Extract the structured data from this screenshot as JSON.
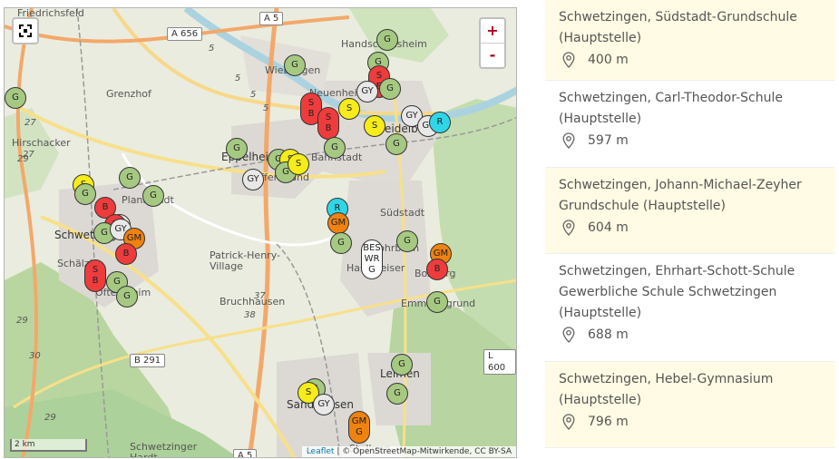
{
  "map": {
    "places": [
      {
        "id": "friedrichsfeld",
        "label": "Friedrichsfeld"
      },
      {
        "id": "handschuhsheim",
        "label": "Handschuhsheim"
      },
      {
        "id": "wieblingen",
        "label": "Wieblingen"
      },
      {
        "id": "neuenheim",
        "label": "Neuenheim"
      },
      {
        "id": "grenzhof",
        "label": "Grenzhof"
      },
      {
        "id": "hirschacker",
        "label": "Hirschacker"
      },
      {
        "id": "heidelberg",
        "label": "Heidelberg"
      },
      {
        "id": "eppelheim",
        "label": "Eppelheim"
      },
      {
        "id": "pfaffengrund",
        "label": "Pfaffengrund"
      },
      {
        "id": "bahnstadt",
        "label": "Bahnstadt"
      },
      {
        "id": "plankstadt",
        "label": "Plankstadt"
      },
      {
        "id": "schwetzingen",
        "label": "Schwetzingen"
      },
      {
        "id": "suedstadt",
        "label": "Südstadt"
      },
      {
        "id": "rohrbach",
        "label": "Rohrbach"
      },
      {
        "id": "patrick",
        "label": "Patrick-Henry-\nVillage"
      },
      {
        "id": "hasenleiser",
        "label": "Hasenleiser"
      },
      {
        "id": "boxberg",
        "label": "Boxberg"
      },
      {
        "id": "schaelzig",
        "label": "Schälzig"
      },
      {
        "id": "oftersheim",
        "label": "Oftersheim"
      },
      {
        "id": "emmertsgrund",
        "label": "Emmertsgrund"
      },
      {
        "id": "bruchhausen",
        "label": "Bruchhausen"
      },
      {
        "id": "leimen",
        "label": "Leimen"
      },
      {
        "id": "sandhausen",
        "label": "Sandhausen"
      },
      {
        "id": "hardt",
        "label": "Schwetzinger\nHardt"
      },
      {
        "id": "st-ilgen",
        "label": "St. Ilgen"
      }
    ],
    "road_shields": [
      {
        "id": "a5-top",
        "label": "A 5"
      },
      {
        "id": "a656",
        "label": "A 656"
      },
      {
        "id": "b291",
        "label": "B 291"
      },
      {
        "id": "l600",
        "label": "L 600"
      },
      {
        "id": "a5-bottom",
        "label": "A 5"
      }
    ],
    "road_numbers": [
      "5",
      "5",
      "5",
      "5",
      "37",
      "38",
      "29",
      "29",
      "30",
      "29",
      "27",
      "27"
    ],
    "markers": [
      {
        "lines": [
          "G"
        ],
        "color": "#a6c982"
      },
      {
        "lines": [
          "G"
        ],
        "color": "#a6c982"
      },
      {
        "lines": [
          "G"
        ],
        "color": "#a6c982"
      },
      {
        "lines": [
          "S",
          "B"
        ],
        "color": "#ee3c3c"
      },
      {
        "lines": [
          "GY"
        ],
        "color": "#e8e8e8"
      },
      {
        "lines": [
          "G"
        ],
        "color": "#a6c982"
      },
      {
        "lines": [
          "S"
        ],
        "color": "#f5ec1a"
      },
      {
        "lines": [
          "S",
          "B"
        ],
        "color": "#ee3c3c"
      },
      {
        "lines": [
          "S",
          "B"
        ],
        "color": "#ee3c3c"
      },
      {
        "lines": [
          "S"
        ],
        "color": "#f5ec1a"
      },
      {
        "lines": [
          "GY"
        ],
        "color": "#e8e8e8"
      },
      {
        "lines": [
          "GY"
        ],
        "color": "#e8e8e8"
      },
      {
        "lines": [
          "R"
        ],
        "color": "#2fd6e8"
      },
      {
        "lines": [
          "G"
        ],
        "color": "#a6c982"
      },
      {
        "lines": [
          "G"
        ],
        "color": "#a6c982"
      },
      {
        "lines": [
          "G"
        ],
        "color": "#a6c982"
      },
      {
        "lines": [
          "G"
        ],
        "color": "#a6c982"
      },
      {
        "lines": [
          "S"
        ],
        "color": "#f5ec1a"
      },
      {
        "lines": [
          "GY"
        ],
        "color": "#e8e8e8"
      },
      {
        "lines": [
          "G"
        ],
        "color": "#a6c982"
      },
      {
        "lines": [
          "S"
        ],
        "color": "#f5ec1a"
      },
      {
        "lines": [
          "S"
        ],
        "color": "#f5ec1a"
      },
      {
        "lines": [
          "G"
        ],
        "color": "#a6c982"
      },
      {
        "lines": [
          "G"
        ],
        "color": "#a6c982"
      },
      {
        "lines": [
          "G"
        ],
        "color": "#a6c982"
      },
      {
        "lines": [
          "B"
        ],
        "color": "#ee3c3c"
      },
      {
        "lines": [
          "GY"
        ],
        "color": "#e8e8e8"
      },
      {
        "lines": [
          "B"
        ],
        "color": "#ee3c3c"
      },
      {
        "lines": [
          "G"
        ],
        "color": "#a6c982"
      },
      {
        "lines": [
          "GY"
        ],
        "color": "#e8e8e8"
      },
      {
        "lines": [
          "GM"
        ],
        "color": "#f0820f"
      },
      {
        "lines": [
          "B"
        ],
        "color": "#ee3c3c"
      },
      {
        "lines": [
          "R"
        ],
        "color": "#2fd6e8"
      },
      {
        "lines": [
          "GM"
        ],
        "color": "#f0820f"
      },
      {
        "lines": [
          "G"
        ],
        "color": "#a6c982"
      },
      {
        "lines": [
          "BES",
          "WR",
          "G"
        ],
        "color": "#ffffff"
      },
      {
        "lines": [
          "G"
        ],
        "color": "#a6c982"
      },
      {
        "lines": [
          "GM"
        ],
        "color": "#f0820f"
      },
      {
        "lines": [
          "B"
        ],
        "color": "#ee3c3c"
      },
      {
        "lines": [
          "S",
          "B"
        ],
        "color": "#ee3c3c"
      },
      {
        "lines": [
          "G"
        ],
        "color": "#a6c982"
      },
      {
        "lines": [
          "G"
        ],
        "color": "#a6c982"
      },
      {
        "lines": [
          "G"
        ],
        "color": "#a6c982"
      },
      {
        "lines": [
          "G"
        ],
        "color": "#a6c982"
      },
      {
        "lines": [
          "G"
        ],
        "color": "#a6c982"
      },
      {
        "lines": [
          "G"
        ],
        "color": "#a6c982"
      },
      {
        "lines": [
          "S"
        ],
        "color": "#f5ec1a"
      },
      {
        "lines": [
          "GY"
        ],
        "color": "#e8e8e8"
      },
      {
        "lines": [
          "GM",
          "G"
        ],
        "color": "#f0820f"
      },
      {
        "lines": [
          "G"
        ],
        "color": "#a6c982"
      }
    ],
    "zoom_in_label": "+",
    "zoom_out_label": "-",
    "scale_label": "2 km",
    "attribution_link": "Leaflet",
    "attribution_text": " | © OpenStreetMap-Mitwirkende, CC BY-SA"
  },
  "results": [
    {
      "name": "Schwetzingen, Südstadt-Grundschule (Hauptstelle)",
      "distance": "400 m"
    },
    {
      "name": "Schwetzingen, Carl-Theodor-Schule (Hauptstelle)",
      "distance": "597 m"
    },
    {
      "name": "Schwetzingen, Johann-Michael-Zeyher Grundschule (Hauptstelle)",
      "distance": "604 m"
    },
    {
      "name": "Schwetzingen, Ehrhart-Schott-Schule Gewerbliche Schule Schwetzingen (Hauptstelle)",
      "distance": "688 m"
    },
    {
      "name": "Schwetzingen, Hebel-Gymnasium (Hauptstelle)",
      "distance": "796 m"
    }
  ]
}
